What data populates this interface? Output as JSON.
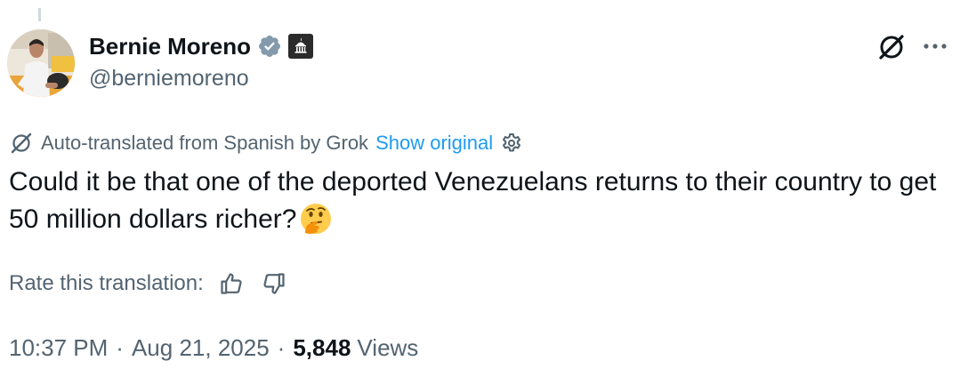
{
  "author": {
    "display_name": "Bernie Moreno",
    "handle": "@berniemoreno",
    "verified_badge_icon": "verified-badge-icon",
    "affiliate_badge_icon": "government-building-icon",
    "avatar_icon": "profile-photo"
  },
  "header_actions": {
    "grok_icon": "grok-icon",
    "more_icon": "more-options-icon"
  },
  "translation": {
    "notice": "Auto-translated from Spanish by Grok",
    "show_original": "Show original",
    "settings_icon": "gear-icon"
  },
  "tweet": {
    "text": "Could it be that one of the deported Venezuelans returns to their country to get 50 million dollars richer?",
    "emoji": "🤔"
  },
  "rating": {
    "label": "Rate this translation:",
    "thumbs_up_icon": "thumbs-up-icon",
    "thumbs_down_icon": "thumbs-down-icon"
  },
  "meta": {
    "time": "10:37 PM",
    "date": "Aug 21, 2025",
    "separator": "·",
    "views_count": "5,848",
    "views_label": "Views"
  },
  "colors": {
    "text_primary": "#0f1419",
    "text_secondary": "#536471",
    "link": "#1d9bf0",
    "verified": "#829aab"
  }
}
